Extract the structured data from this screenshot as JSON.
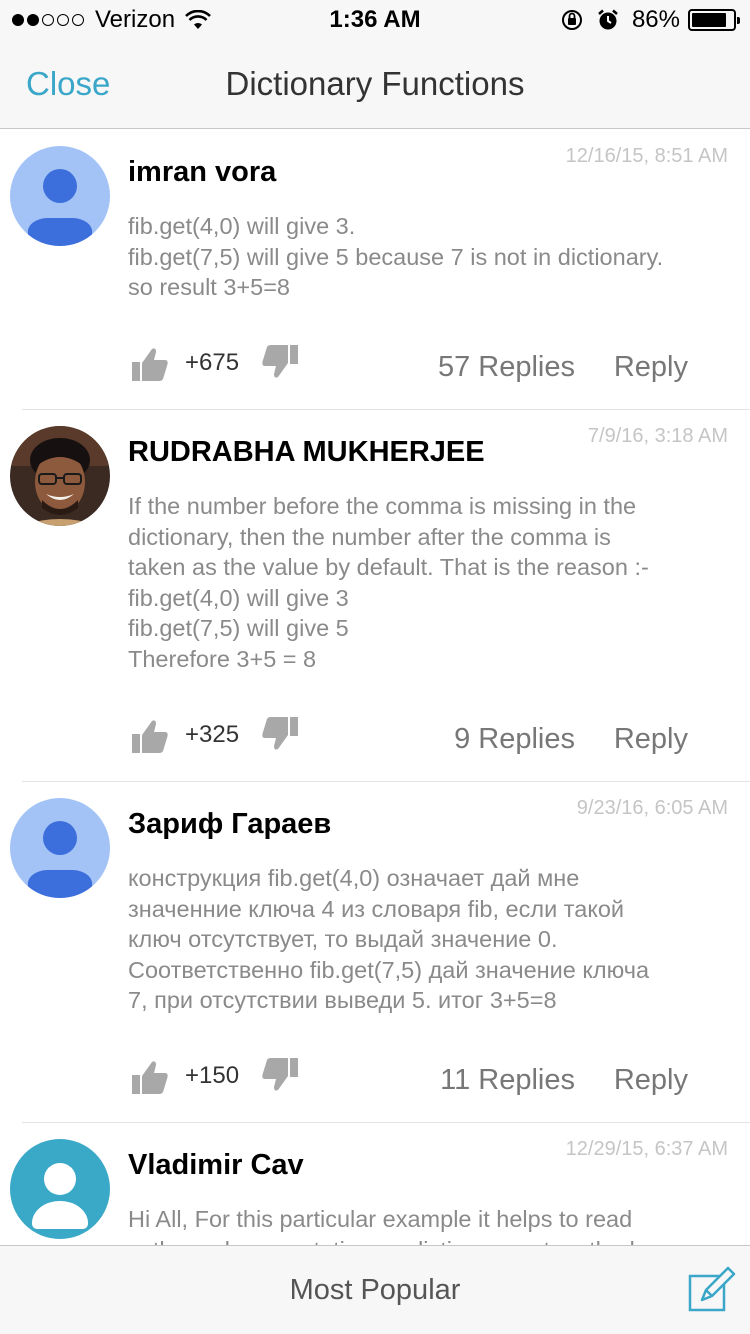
{
  "status_bar": {
    "carrier": "Verizon",
    "time": "1:36 AM",
    "battery": "86%",
    "battery_level": 0.86,
    "signal_bars": 2
  },
  "nav": {
    "close_label": "Close",
    "title": "Dictionary Functions"
  },
  "comments": [
    {
      "author": "imran vora",
      "date": "12/16/15, 8:51 AM",
      "body": "fib.get(4,0) will give 3.\nfib.get(7,5) will give 5 because 7 is not in dictionary.\nso result 3+5=8",
      "votes": "+675",
      "replies": "57 Replies",
      "reply_label": "Reply",
      "avatar": "default-person-icon"
    },
    {
      "author": "RUDRABHA MUKHERJEE",
      "date": "7/9/16, 3:18 AM",
      "body": "If the number before the comma is missing in the\ndictionary, then the number after the comma is\ntaken as the value by default. That is the reason :-\nfib.get(4,0) will give 3\nfib.get(7,5) will give 5\nTherefore 3+5 = 8",
      "votes": "+325",
      "replies": "9 Replies",
      "reply_label": "Reply",
      "avatar": "profile-photo"
    },
    {
      "author": "Зариф Гараев",
      "date": "9/23/16, 6:05 AM",
      "body": "конструкция fib.get(4,0) означает дай мне\nзначенние ключа 4 из словаря fib, если такой\nключ отсутствует, то выдай значение 0.\nСоответственно fib.get(7,5)  дай значение ключа\n7, при  отсутствии выведи 5. итог 3+5=8",
      "votes": "+150",
      "replies": "11 Replies",
      "reply_label": "Reply",
      "avatar": "default-person-icon"
    },
    {
      "author": "Vladimir Cav",
      "date": "12/29/15, 6:37 AM",
      "body": "Hi All, For this particular example it helps to read\npythons documentation on dictionary get method",
      "avatar": "teal-person-icon"
    }
  ],
  "bottom_bar": {
    "title": "Most Popular",
    "compose_icon": "compose-icon"
  },
  "colors": {
    "accent": "#3aa7c9",
    "default_avatar_bg": "#a3c3f7",
    "default_avatar_fg": "#3c6fdc",
    "teal_avatar_bg": "#3aa9c8"
  }
}
